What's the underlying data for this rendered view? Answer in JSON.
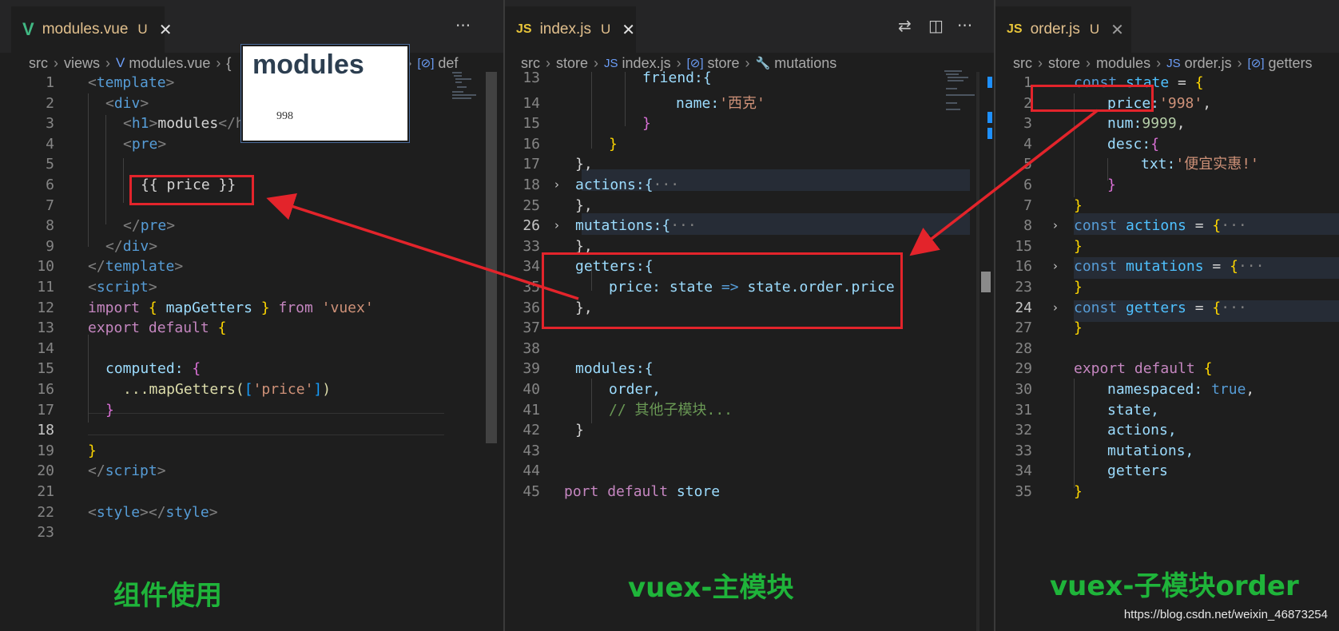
{
  "left": {
    "tab": {
      "icon": "vue-icon",
      "name": "modules.vue",
      "state": "U",
      "close": "✕"
    },
    "more": "···",
    "breadcrumb": [
      "src",
      "views",
      "modules.vue",
      "{",
      "t",
      "def"
    ],
    "lines": [
      {
        "n": "1"
      },
      {
        "n": "2"
      },
      {
        "n": "3"
      },
      {
        "n": "4"
      },
      {
        "n": "5"
      },
      {
        "n": "6"
      },
      {
        "n": "7"
      },
      {
        "n": "8"
      },
      {
        "n": "9"
      },
      {
        "n": "10"
      },
      {
        "n": "11"
      },
      {
        "n": "12"
      },
      {
        "n": "13"
      },
      {
        "n": "14"
      },
      {
        "n": "15"
      },
      {
        "n": "16"
      },
      {
        "n": "17"
      },
      {
        "n": "18"
      },
      {
        "n": "19"
      },
      {
        "n": "20"
      },
      {
        "n": "21"
      },
      {
        "n": "22"
      },
      {
        "n": "23"
      }
    ],
    "code": {
      "l1": "template",
      "l2": "div",
      "l3a": "h1",
      "l3b": "modules",
      "l3c": "</h1",
      "l4": "pre",
      "l6": "{{ price }}",
      "l8": "pre",
      "l9": "div",
      "l10": "template",
      "l11": "script",
      "l12a": "import",
      "l12b": "mapGetters",
      "l12c": "from",
      "l12d": "'vuex'",
      "l13a": "export",
      "l13b": "default",
      "l15": "computed:",
      "l16a": "...mapGetters(",
      "l16b": "'price'",
      "l20": "script",
      "l22a": "style",
      "l22b": "style"
    },
    "popup": {
      "title": "modules",
      "value": "998"
    },
    "caption": "组件使用"
  },
  "middle": {
    "tab": {
      "icon": "JS",
      "name": "index.js",
      "state": "U",
      "close": "✕"
    },
    "tools": {
      "compare": "⇄",
      "split": "◫",
      "more": "···"
    },
    "breadcrumb": [
      "src",
      "store",
      "index.js",
      "store",
      "mutations"
    ],
    "lines": [
      {
        "n": "13"
      },
      {
        "n": "14"
      },
      {
        "n": "15"
      },
      {
        "n": "16"
      },
      {
        "n": "17"
      },
      {
        "n": "18"
      },
      {
        "n": "25"
      },
      {
        "n": "26"
      },
      {
        "n": "33"
      },
      {
        "n": "34"
      },
      {
        "n": "35"
      },
      {
        "n": "36"
      },
      {
        "n": "37"
      },
      {
        "n": "38"
      },
      {
        "n": "39"
      },
      {
        "n": "40"
      },
      {
        "n": "41"
      },
      {
        "n": "42"
      },
      {
        "n": "43"
      },
      {
        "n": "44"
      },
      {
        "n": "45"
      }
    ],
    "code": {
      "l13": "friend:{",
      "l14a": "name:",
      "l14b": "'西克'",
      "l18": "actions:{",
      "l26": "mutations:{",
      "l34": "getters:{",
      "l35a": "price:",
      "l35b": "state",
      "l35c": "=>",
      "l35d": "state.order.price",
      "l39": "modules:{",
      "l40": "order,",
      "l41": "// 其他子模块...",
      "l45a": "port",
      "l45b": "default",
      "l45c": "store",
      "ellipsis": "···"
    },
    "caption": "vuex-主模块"
  },
  "right": {
    "tab": {
      "icon": "JS",
      "name": "order.js",
      "state": "U",
      "close": "✕"
    },
    "breadcrumb": [
      "src",
      "store",
      "modules",
      "order.js",
      "getters"
    ],
    "lines": [
      {
        "n": "1"
      },
      {
        "n": "2"
      },
      {
        "n": "3"
      },
      {
        "n": "4"
      },
      {
        "n": "5"
      },
      {
        "n": "6"
      },
      {
        "n": "7"
      },
      {
        "n": "8"
      },
      {
        "n": "15"
      },
      {
        "n": "16"
      },
      {
        "n": "23"
      },
      {
        "n": "24"
      },
      {
        "n": "27"
      },
      {
        "n": "28"
      },
      {
        "n": "29"
      },
      {
        "n": "30"
      },
      {
        "n": "31"
      },
      {
        "n": "32"
      },
      {
        "n": "33"
      },
      {
        "n": "34"
      },
      {
        "n": "35"
      }
    ],
    "code": {
      "l1a": "const",
      "l1b": "state",
      "l2a": "price:",
      "l2b": "'998'",
      "l3a": "num:",
      "l3b": "9999",
      "l4": "desc:",
      "l5a": "txt:",
      "l5b": "'便宜实惠!'",
      "l8a": "const",
      "l8b": "actions",
      "l16a": "const",
      "l16b": "mutations",
      "l24a": "const",
      "l24b": "getters",
      "l29a": "export",
      "l29b": "default",
      "l30a": "namespaced:",
      "l30b": "true",
      "l31": "state,",
      "l32": "actions,",
      "l33": "mutations,",
      "l34": "getters",
      "ellipsis": "···"
    },
    "caption": "vuex-子模块order"
  },
  "watermark": "https://blog.csdn.net/weixin_46873254",
  "colors": {
    "annotation": "#e3242b",
    "caption": "#1fb43a",
    "editor_bg": "#1e1e1e"
  }
}
